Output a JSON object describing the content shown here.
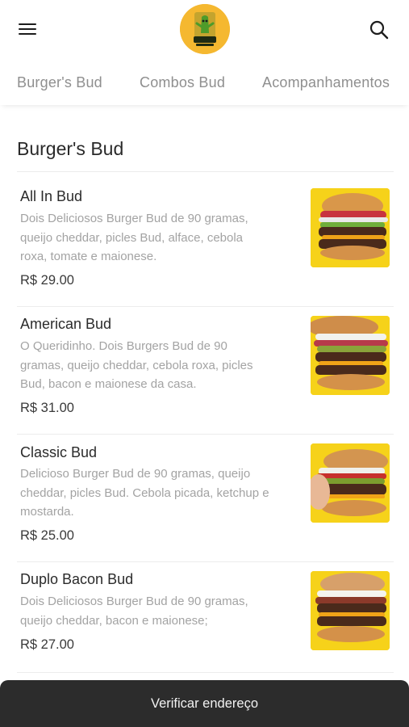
{
  "header": {
    "menu_icon": "hamburger-menu-icon",
    "logo_icon": "bud-burgers-logo",
    "search_icon": "search-icon"
  },
  "tabs": [
    {
      "label": "Burger's Bud"
    },
    {
      "label": "Combos Bud"
    },
    {
      "label": "Acompanhamentos"
    }
  ],
  "section": {
    "title": "Burger's Bud"
  },
  "items": [
    {
      "name": "All In Bud",
      "desc_lines": [
        "Dois Deliciosos Burger Bud de 90 gramas,",
        "queijo cheddar, picles Bud, alface, cebola",
        "roxa, tomate e maionese."
      ],
      "price": "R$ 29.00"
    },
    {
      "name": "American Bud",
      "desc_lines": [
        "O Queridinho. Dois Burgers Bud de 90",
        "gramas, queijo cheddar, cebola roxa, picles",
        "Bud, bacon e maionese da casa."
      ],
      "price": "R$ 31.00"
    },
    {
      "name": "Classic Bud",
      "desc_lines": [
        "Delicioso Burger Bud de 90 gramas, queijo",
        "cheddar, picles Bud. Cebola picada, ketchup e",
        "mostarda."
      ],
      "price": "R$ 25.00"
    },
    {
      "name": "Duplo Bacon Bud",
      "desc_lines": [
        "Dois Deliciosos Burger Bud de 90 gramas,",
        "queijo cheddar, bacon e maionese;"
      ],
      "price": "R$ 27.00"
    }
  ],
  "footer": {
    "button_label": "Verificar endereço"
  },
  "colors": {
    "accent_yellow": "#f6d21a",
    "logo_orange": "#f5b830",
    "footer_bg": "#2c2c2c"
  }
}
